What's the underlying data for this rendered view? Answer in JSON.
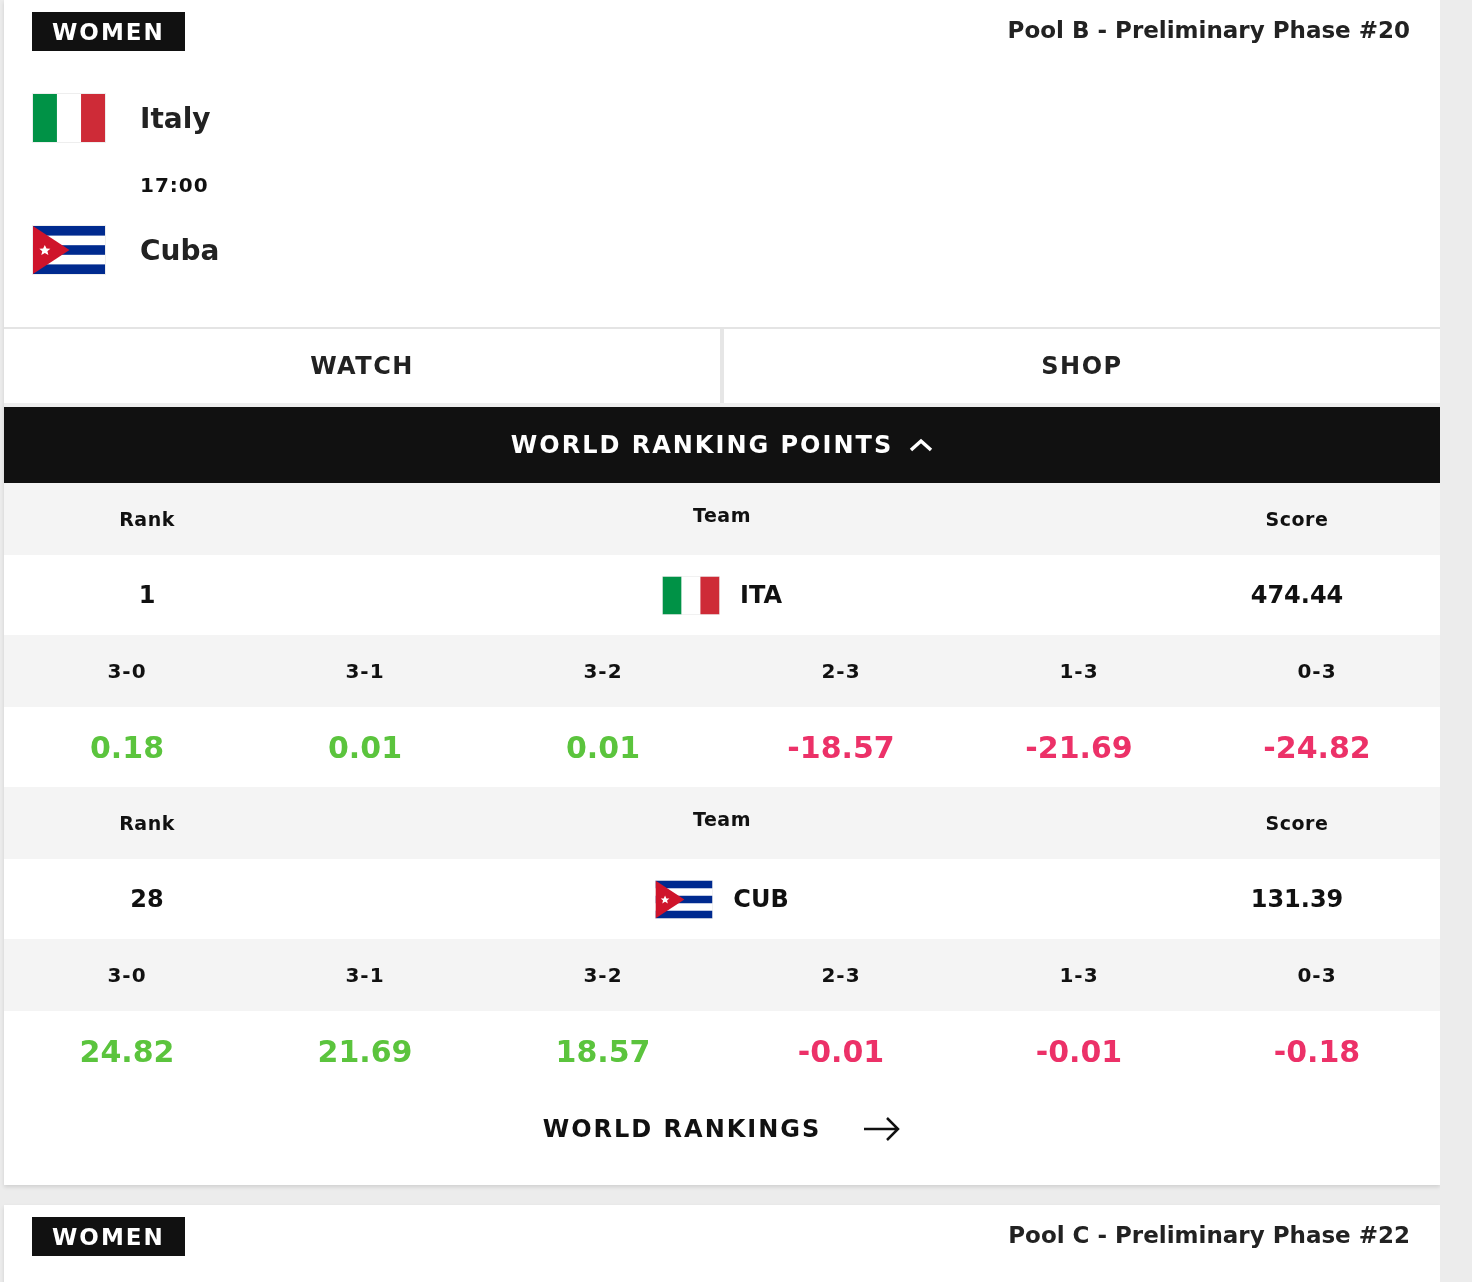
{
  "matches": [
    {
      "category": "WOMEN",
      "pool": "Pool B - Preliminary Phase #20",
      "teams": [
        {
          "name": "Italy",
          "kind": "italy"
        },
        {
          "name": "Cuba",
          "kind": "cuba"
        }
      ],
      "time": "17:00",
      "actions": [
        "WATCH",
        "SHOP"
      ],
      "ranking": {
        "title": "WORLD RANKING POINTS",
        "expanded": true,
        "entries": [
          {
            "headers": [
              "Rank",
              "Team",
              "Score"
            ],
            "rank": "1",
            "code": "ITA",
            "kind": "italy",
            "score": "474.44",
            "outcomes": [
              {
                "label": "3-0",
                "value": "0.18",
                "kind": "gain"
              },
              {
                "label": "3-1",
                "value": "0.01",
                "kind": "gain"
              },
              {
                "label": "3-2",
                "value": "0.01",
                "kind": "gain"
              },
              {
                "label": "2-3",
                "value": "-18.57",
                "kind": "loss"
              },
              {
                "label": "1-3",
                "value": "-21.69",
                "kind": "loss"
              },
              {
                "label": "0-3",
                "value": "-24.82",
                "kind": "loss"
              }
            ]
          },
          {
            "headers": [
              "Rank",
              "Team",
              "Score"
            ],
            "rank": "28",
            "code": "CUB",
            "kind": "cuba",
            "score": "131.39",
            "outcomes": [
              {
                "label": "3-0",
                "value": "24.82",
                "kind": "gain"
              },
              {
                "label": "3-1",
                "value": "21.69",
                "kind": "gain"
              },
              {
                "label": "3-2",
                "value": "18.57",
                "kind": "gain"
              },
              {
                "label": "2-3",
                "value": "-0.01",
                "kind": "loss"
              },
              {
                "label": "1-3",
                "value": "-0.01",
                "kind": "loss"
              },
              {
                "label": "0-3",
                "value": "-0.18",
                "kind": "loss"
              }
            ]
          }
        ],
        "link": "WORLD RANKINGS"
      }
    },
    {
      "category": "WOMEN",
      "pool": "Pool C - Preliminary Phase #22"
    }
  ]
}
